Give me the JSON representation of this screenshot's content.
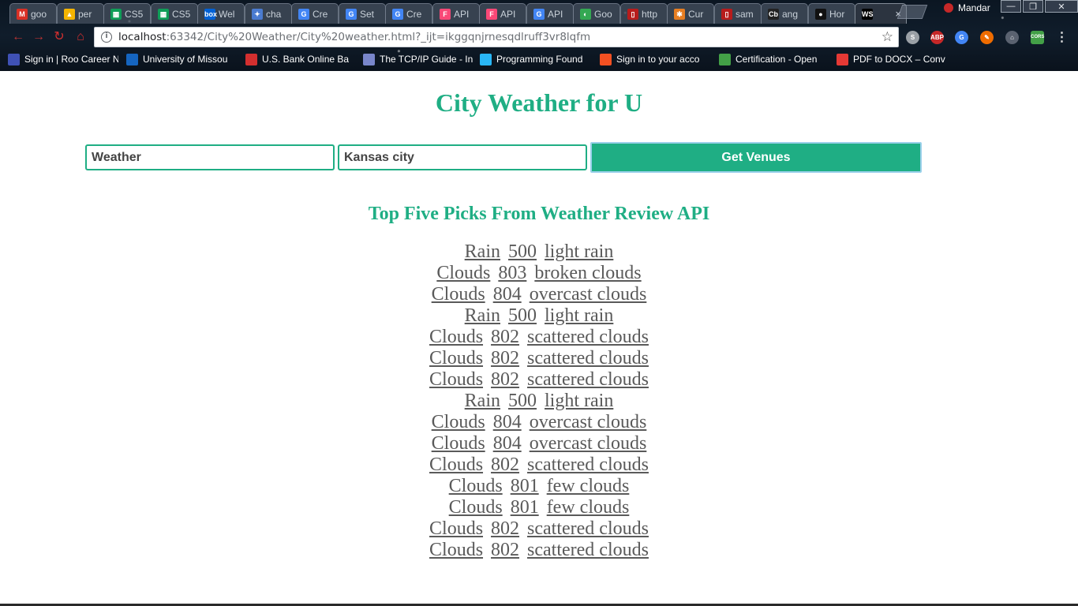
{
  "browser": {
    "tabs": [
      {
        "title": "goo",
        "icon": "gmail-icon",
        "color": "#d93025",
        "glyph": "M"
      },
      {
        "title": "per",
        "icon": "google-drive-icon",
        "color": "#f4b400",
        "glyph": "▲"
      },
      {
        "title": "CS5",
        "icon": "google-sheets-icon",
        "color": "#0f9d58",
        "glyph": "▦"
      },
      {
        "title": "CS5",
        "icon": "google-sheets-icon",
        "color": "#0f9d58",
        "glyph": "▦"
      },
      {
        "title": "Wel",
        "icon": "box-icon",
        "color": "#0061d5",
        "glyph": "box"
      },
      {
        "title": "cha",
        "icon": "puzzle-icon",
        "color": "#4a7bd0",
        "glyph": "✦"
      },
      {
        "title": "Cre",
        "icon": "google-icon",
        "color": "#4285f4",
        "glyph": "G"
      },
      {
        "title": "Set",
        "icon": "google-icon",
        "color": "#4285f4",
        "glyph": "G"
      },
      {
        "title": "Cre",
        "icon": "google-icon",
        "color": "#4285f4",
        "glyph": "G"
      },
      {
        "title": "API",
        "icon": "foursquare-icon",
        "color": "#f94877",
        "glyph": "F"
      },
      {
        "title": "API",
        "icon": "foursquare-icon",
        "color": "#f94877",
        "glyph": "F"
      },
      {
        "title": "API",
        "icon": "google-icon",
        "color": "#4285f4",
        "glyph": "G"
      },
      {
        "title": "Goo",
        "icon": "google-play-icon",
        "color": "#34a853",
        "glyph": "◐"
      },
      {
        "title": "http",
        "icon": "pdf-document-icon",
        "color": "#b71c1c",
        "glyph": "▯"
      },
      {
        "title": "Cur",
        "icon": "orange-app-icon",
        "color": "#e67e22",
        "glyph": "✱"
      },
      {
        "title": "sam",
        "icon": "pdf-document-icon",
        "color": "#b71c1c",
        "glyph": "▯"
      },
      {
        "title": "ang",
        "icon": "codebase-icon",
        "color": "#222222",
        "glyph": "Cb"
      },
      {
        "title": "Hor",
        "icon": "github-icon",
        "color": "#111111",
        "glyph": "●"
      },
      {
        "title": "",
        "icon": "webstorm-icon",
        "color": "#000000",
        "glyph": "WS",
        "active": true
      }
    ],
    "tab_close": "×",
    "profile_name": "Mandar",
    "window_controls": {
      "minimize": "—",
      "restore": "❐",
      "close": "✕"
    },
    "address": {
      "host": "localhost",
      "rest": ":63342/City%20Weather/City%20weather.html?_ijt=ikggqnjrnesqdlruff3vr8lqfm",
      "info_glyph": "i",
      "star_glyph": "☆"
    },
    "extensions": [
      {
        "name": "skype-extension-icon",
        "color": "#9aa0a6",
        "glyph": "S"
      },
      {
        "name": "adblock-plus-icon",
        "color": "#c62828",
        "glyph": "ABP"
      },
      {
        "name": "google-translate-icon",
        "color": "#4285f4",
        "glyph": "G"
      },
      {
        "name": "orange-extension-icon",
        "color": "#ef6c00",
        "glyph": "✎"
      },
      {
        "name": "home-extension-icon",
        "color": "#5a6270",
        "glyph": "⌂"
      },
      {
        "name": "cors-extension-icon",
        "color": "#43a047",
        "glyph": "CORS"
      },
      {
        "name": "menu-icon",
        "color": "transparent",
        "glyph": "⋮"
      }
    ],
    "bookmarks": [
      {
        "label": "Sign in | Roo Career N",
        "icon": "roo-career-icon",
        "color": "#3f51b5"
      },
      {
        "label": "University of Missou",
        "icon": "umkc-icon",
        "color": "#1565c0"
      },
      {
        "label": "U.S. Bank Online Ba",
        "icon": "us-bank-icon",
        "color": "#d32f2f"
      },
      {
        "label": "The TCP/IP Guide - In",
        "icon": "tcpip-guide-icon",
        "color": "#7986cb"
      },
      {
        "label": "Programming Found",
        "icon": "programming-icon",
        "color": "#29b6f6"
      },
      {
        "label": "Sign in to your acco",
        "icon": "microsoft-icon",
        "color": "#f25022"
      },
      {
        "label": "Certification - Open",
        "icon": "certification-icon",
        "color": "#43a047"
      },
      {
        "label": "PDF to DOCX – Conv",
        "icon": "pdf-to-docx-icon",
        "color": "#e53935"
      }
    ]
  },
  "page": {
    "title": "City Weather for U",
    "venue_input_value": "Weather",
    "city_input_value": "Kansas city",
    "submit_label": "Get Venues",
    "results_heading": "Top Five Picks From Weather Review API",
    "results": [
      [
        "Rain",
        "500",
        "light rain"
      ],
      [
        "Clouds",
        "803",
        "broken clouds"
      ],
      [
        "Clouds",
        "804",
        "overcast clouds"
      ],
      [
        "Rain",
        "500",
        "light rain"
      ],
      [
        "Clouds",
        "802",
        "scattered clouds"
      ],
      [
        "Clouds",
        "802",
        "scattered clouds"
      ],
      [
        "Clouds",
        "802",
        "scattered clouds"
      ],
      [
        "Rain",
        "500",
        "light rain"
      ],
      [
        "Clouds",
        "804",
        "overcast clouds"
      ],
      [
        "Clouds",
        "804",
        "overcast clouds"
      ],
      [
        "Clouds",
        "802",
        "scattered clouds"
      ],
      [
        "Clouds",
        "801",
        "few clouds"
      ],
      [
        "Clouds",
        "801",
        "few clouds"
      ],
      [
        "Clouds",
        "802",
        "scattered clouds"
      ],
      [
        "Clouds",
        "802",
        "scattered clouds"
      ]
    ],
    "colors": {
      "accent": "#1fae84",
      "link": "#5a5a5a"
    }
  }
}
